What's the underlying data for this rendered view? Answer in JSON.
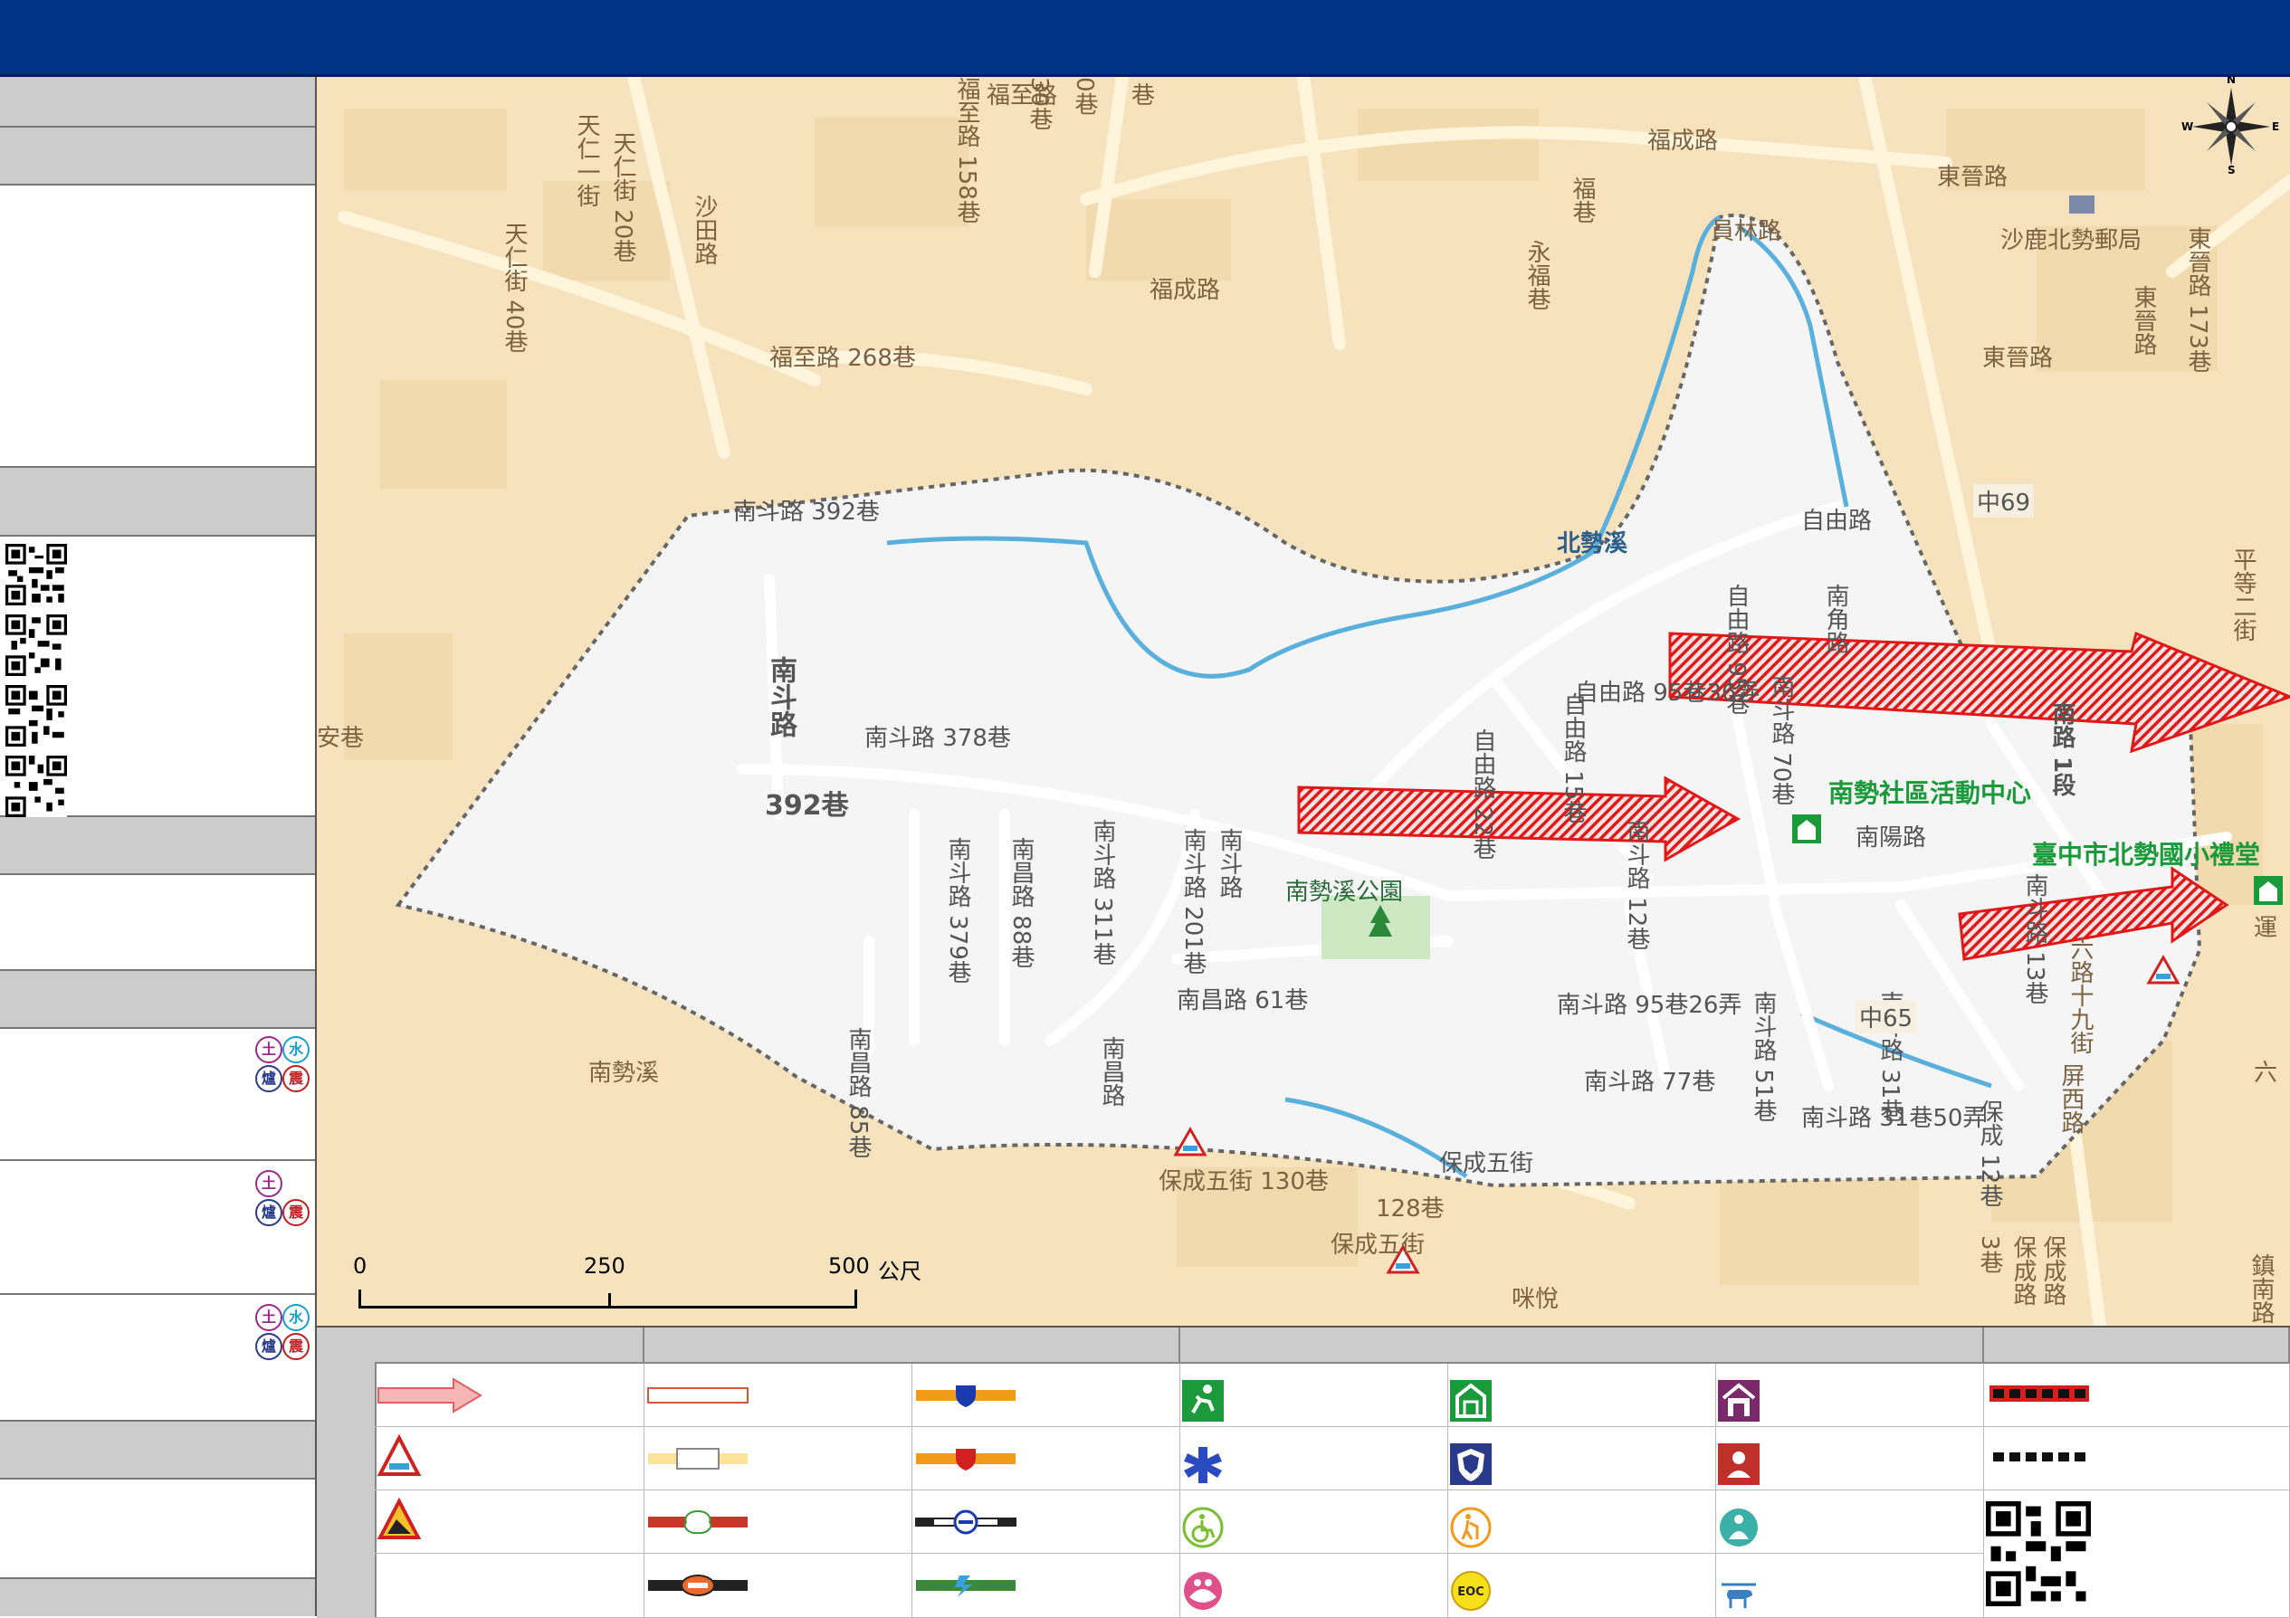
{
  "map": {
    "road_labels": [
      "天仁一街",
      "天仁街 20巷",
      "天仁街 40巷",
      "沙田路",
      "福至路",
      "福至路 158巷",
      "30巷",
      "0巷",
      "巷",
      "福成路",
      "福成路",
      "福至路 268巷",
      "永福巷",
      "福巷",
      "員林路",
      "東晉路",
      "沙鹿北勢郵局",
      "東晉路 173巷",
      "東晉路",
      "東晉路",
      "南斗路 392巷",
      "南斗路",
      "392巷",
      "南斗路 378巷",
      "北勢溪",
      "自由路",
      "自由路 95巷",
      "自由路 95巷36弄",
      "自由路 22巷",
      "自由路 15巷",
      "南斗路 12巷",
      "南斗路 70巷",
      "南角路",
      "中69",
      "平等二街",
      "南路 1段",
      "南陽路",
      "南斗路 13巷",
      "南斗路 311巷",
      "南昌路 88巷",
      "南斗路 379巷",
      "南斗路 201巷",
      "南斗路",
      "南昌路 61巷",
      "南斗路 95巷26弄",
      "南斗路 51巷",
      "南斗路 31巷",
      "南斗路 77巷",
      "南斗路 31巷50弄",
      "中65",
      "六路十九街",
      "屏西路",
      "南昌路",
      "南昌路 85巷",
      "南勢溪",
      "保成五街 130巷",
      "保成五街",
      "128巷",
      "保成五街",
      "保成 12巷",
      "保成路 3巷",
      "保成路",
      "鎮南路",
      "六",
      "安巷",
      "運",
      "咪悅"
    ],
    "facility_labels": [
      "南勢社區活動中心",
      "臺中市北勢國小禮堂",
      "南勢溪公園"
    ],
    "scale": {
      "ticks": [
        "0",
        "250",
        "500"
      ],
      "unit": "公尺"
    },
    "compass": {
      "n": "N",
      "s": "S",
      "e": "E",
      "w": "W"
    }
  },
  "sidebar": {
    "hazards": [
      {
        "glyphs": [
          "土",
          "水",
          "爐",
          "震"
        ]
      },
      {
        "glyphs": [
          "土",
          "爐",
          "震"
        ]
      },
      {
        "glyphs": [
          "土",
          "水",
          "爐",
          "震"
        ]
      }
    ]
  },
  "colors": {
    "header": "#003388",
    "area": "#f5f5f6",
    "route": "#e01818",
    "boundary": "#555555",
    "facility": "#1a9a3a",
    "river": "#5ab0dc"
  }
}
